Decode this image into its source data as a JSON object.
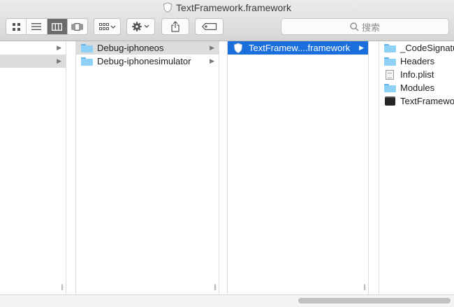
{
  "window": {
    "title": "TextFramework.framework"
  },
  "toolbar": {
    "view_buttons": [
      "icon-view",
      "list-view",
      "column-view",
      "cover-flow-view"
    ],
    "active_view": "column-view",
    "search_placeholder": "搜索"
  },
  "columns": [
    {
      "items": [
        {
          "label": "",
          "selected": false,
          "arrow": true
        },
        {
          "label": "",
          "selected": "gray",
          "arrow": true
        }
      ]
    },
    {
      "items": [
        {
          "label": "Debug-iphoneos",
          "icon": "folder-icon",
          "selected": "gray",
          "arrow": true
        },
        {
          "label": "Debug-iphonesimulator",
          "icon": "folder-icon",
          "selected": false,
          "arrow": true
        }
      ]
    },
    {
      "items": [
        {
          "label": "TextFramew....framework",
          "icon": "framework-shield-icon",
          "selected": "blue",
          "arrow": true
        }
      ]
    },
    {
      "items": [
        {
          "label": "_CodeSignature",
          "icon": "folder-icon"
        },
        {
          "label": "Headers",
          "icon": "folder-icon"
        },
        {
          "label": "Info.plist",
          "icon": "plist-file-icon"
        },
        {
          "label": "Modules",
          "icon": "folder-icon"
        },
        {
          "label": "TextFramework",
          "icon": "executable-icon"
        }
      ]
    }
  ],
  "colors": {
    "selection_blue": "#1a6fdc",
    "selection_gray": "#dcdcdc",
    "folder": "#8fd0f7"
  }
}
